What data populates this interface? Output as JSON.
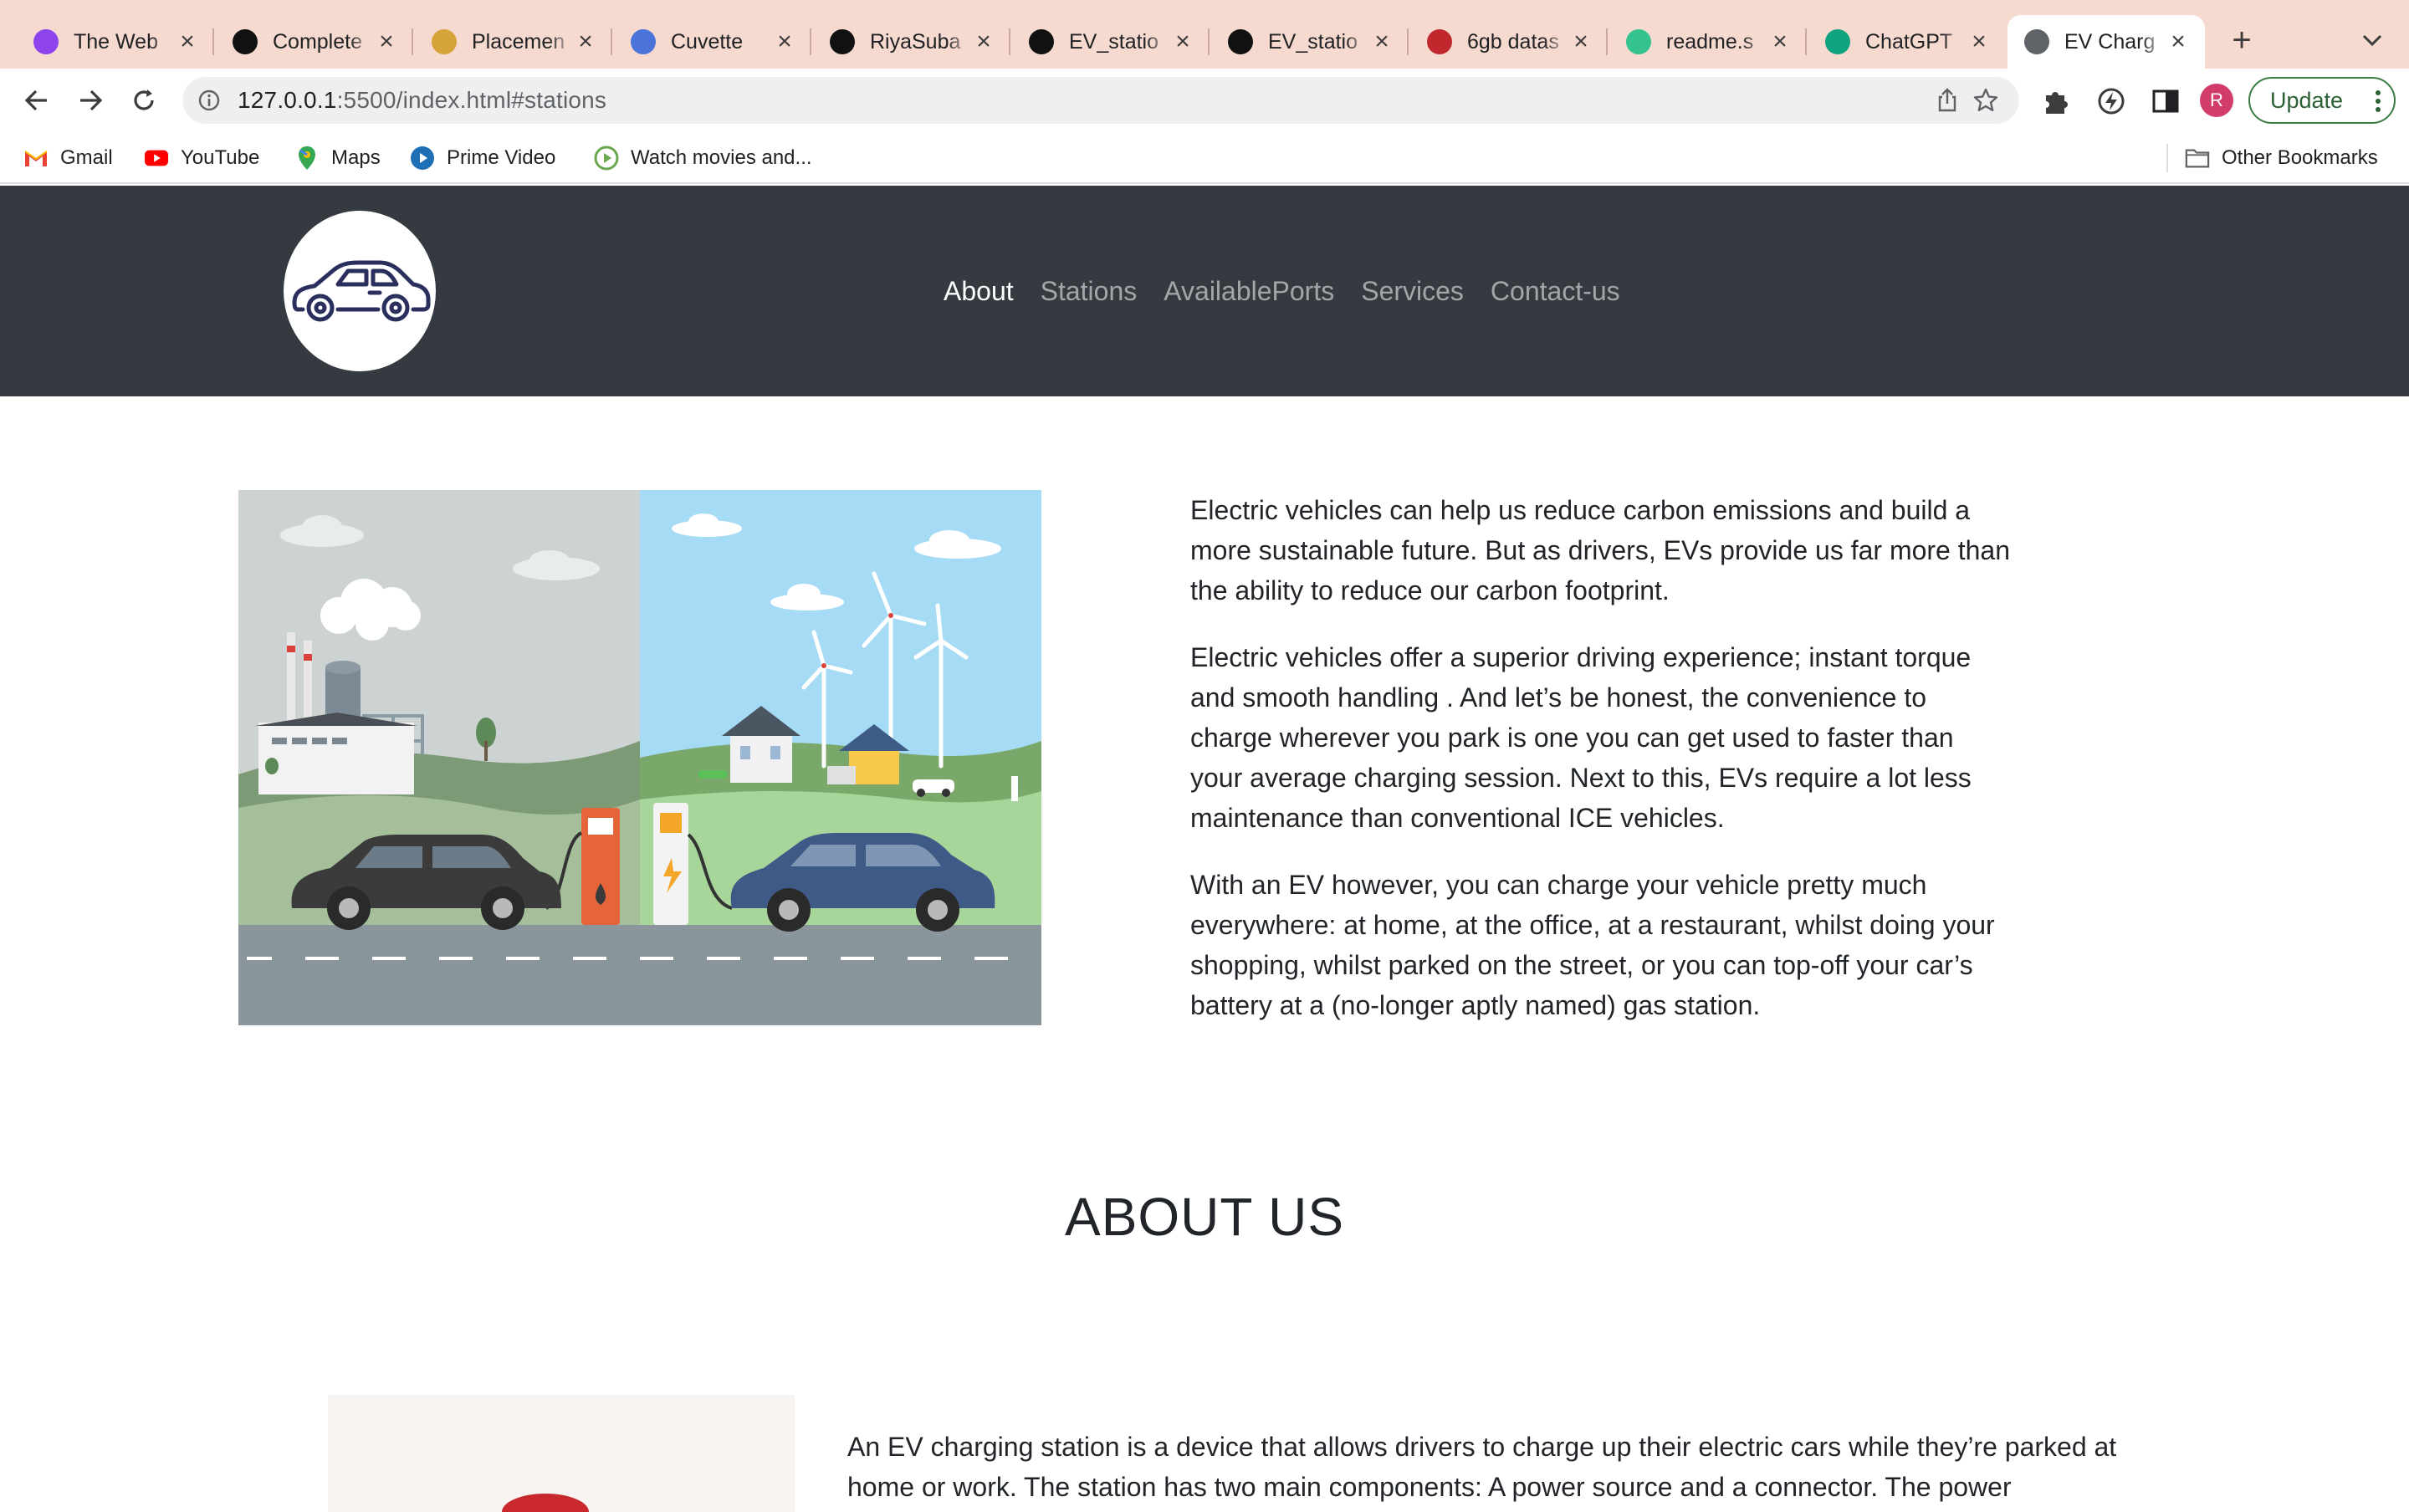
{
  "browser": {
    "tabs": [
      {
        "title": "The Web",
        "icon": "purple-u-icon",
        "color": "#8e44ec"
      },
      {
        "title": "Complete",
        "icon": "notion-icon",
        "color": "#111111"
      },
      {
        "title": "Placemen",
        "icon": "placement-icon",
        "color": "#d6a23a"
      },
      {
        "title": "Cuvette",
        "icon": "cuvette-icon",
        "color": "#4a74d9"
      },
      {
        "title": "RiyaSuba",
        "icon": "github-icon",
        "color": "#111111"
      },
      {
        "title": "EV_statio",
        "icon": "github-icon",
        "color": "#111111"
      },
      {
        "title": "EV_statio",
        "icon": "github-icon",
        "color": "#111111"
      },
      {
        "title": "6gb datas",
        "icon": "infinity-icon",
        "color": "#c0282e"
      },
      {
        "title": "readme.s",
        "icon": "readme-icon",
        "color": "#34c38f"
      },
      {
        "title": "ChatGPT",
        "icon": "chatgpt-icon",
        "color": "#10a37f"
      },
      {
        "title": "EV Charg",
        "icon": "globe-icon",
        "color": "#5f6368"
      }
    ],
    "url_host": "127.0.0.1",
    "url_rest": ":5500/index.html#stations",
    "profile_initial": "R",
    "update_label": "Update",
    "bookmarks": [
      {
        "label": "Gmail",
        "icon": "gmail-icon"
      },
      {
        "label": "YouTube",
        "icon": "youtube-icon"
      },
      {
        "label": "Maps",
        "icon": "maps-icon"
      },
      {
        "label": "Prime Video",
        "icon": "prime-video-icon"
      },
      {
        "label": "Watch movies and...",
        "icon": "play-icon"
      }
    ],
    "other_bookmarks": "Other Bookmarks"
  },
  "site": {
    "nav": [
      "About",
      "Stations",
      "AvailablePorts",
      "Services",
      "Contact-us"
    ],
    "active_nav": "About",
    "intro_paragraphs": [
      "Electric vehicles can help us reduce carbon emissions and build a more sustainable future. But as drivers, EVs provide us far more than the ability to reduce our carbon footprint.",
      "Electric vehicles offer a superior driving experience; instant torque and smooth handling . And let’s be honest, the convenience to charge wherever you park is one you can get used to faster than your average charging session. Next to this, EVs require a lot less maintenance than conventional ICE vehicles.",
      "With an EV however, you can charge your vehicle pretty much everywhere: at home, at the office, at a restaurant, whilst doing your shopping, whilst parked on the street, or you can top-off your car’s battery at a (no-longer aptly named) gas station."
    ],
    "about_heading": "ABOUT US",
    "station_text": "An EV charging station is a device that allows drivers to charge up their electric cars while they’re parked at home or work. The station has two main components: A power source and a connector. The power"
  }
}
